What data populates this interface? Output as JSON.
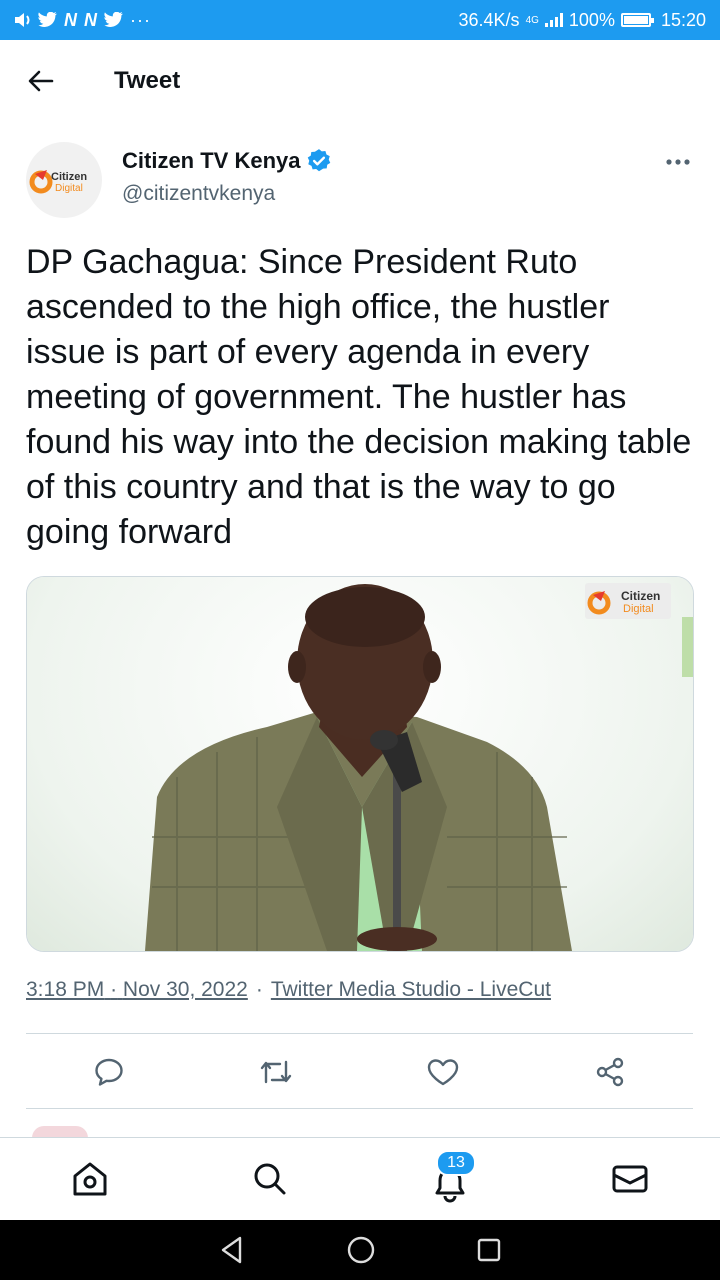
{
  "status_bar": {
    "speed": "36.4K/s",
    "network": "4G",
    "battery": "100%",
    "time": "15:20",
    "notification_icons": [
      "volume-icon",
      "twitter-icon",
      "n-icon",
      "n-icon",
      "twitter-icon",
      "more-dots-icon"
    ]
  },
  "header": {
    "title": "Tweet"
  },
  "tweet": {
    "display_name": "Citizen TV Kenya",
    "handle": "@citizentvkenya",
    "verified": true,
    "avatar_text_1": "Citizen",
    "avatar_text_2": "Digital",
    "text": "DP Gachagua: Since President Ruto ascended to the high office, the hustler issue is part of every agenda in every meeting of government. The hustler has found his way into the decision making table of this country and that is the way to go going forward",
    "media_watermark_1": "Citizen",
    "media_watermark_2": "Digital",
    "time": "3:18 PM",
    "date": "Nov 30, 2022",
    "separator": "·",
    "source": "Twitter Media Studio - LiveCut"
  },
  "actions": [
    "reply-icon",
    "retweet-icon",
    "like-icon",
    "share-icon"
  ],
  "bottom_nav": {
    "items": [
      "home-icon",
      "search-icon",
      "notifications-icon",
      "messages-icon"
    ],
    "notifications_badge": "13"
  },
  "colors": {
    "accent": "#1d9bf0",
    "text": "#0f1419",
    "secondary": "#536471",
    "border": "#cfd9de"
  }
}
